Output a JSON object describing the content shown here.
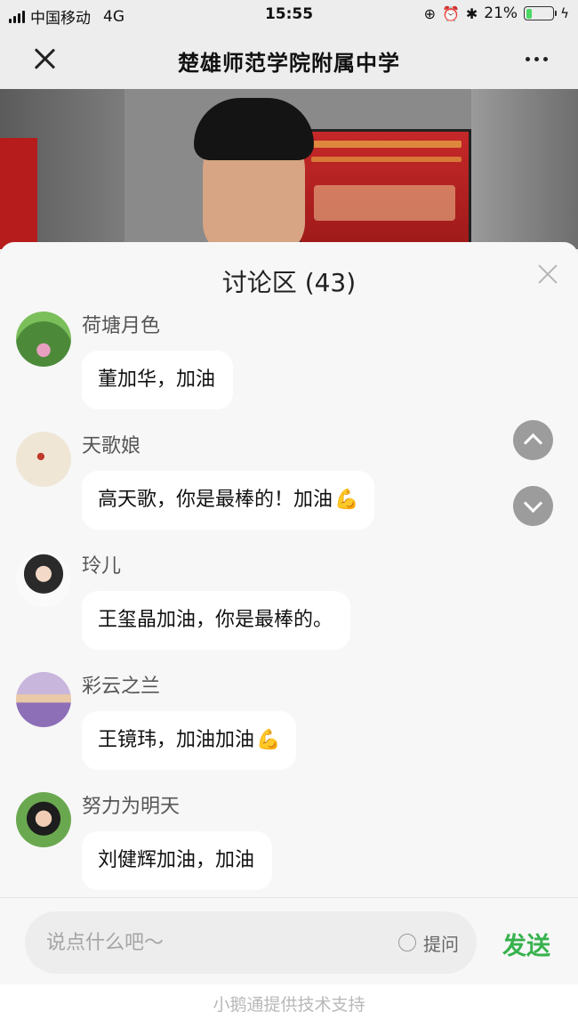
{
  "status_bar": {
    "carrier": "中国移动",
    "network": "4G",
    "time": "15:55",
    "battery_pct": "21%",
    "battery_level": 0.21
  },
  "nav": {
    "title": "楚雄师范学院附属中学"
  },
  "discussion": {
    "title": "讨论区 (43)",
    "messages": [
      {
        "nick": "荷塘月色",
        "text": "董加华，加油",
        "emoji": ""
      },
      {
        "nick": "天歌娘",
        "text": "高天歌，你是最棒的！加油",
        "emoji": "💪"
      },
      {
        "nick": "玲儿",
        "text": "王玺晶加油，你是最棒的。",
        "emoji": ""
      },
      {
        "nick": "彩云之兰",
        "text": "王镜玮，加油加油",
        "emoji": "💪"
      },
      {
        "nick": "努力为明天",
        "text": "刘健辉加油，加油",
        "emoji": ""
      }
    ]
  },
  "composer": {
    "placeholder": "说点什么吧～",
    "ask_label": "提问",
    "send_label": "发送"
  },
  "footer": {
    "text": "小鹅通提供技术支持"
  },
  "colors": {
    "send": "#37b24d",
    "battery": "#4cd964"
  }
}
